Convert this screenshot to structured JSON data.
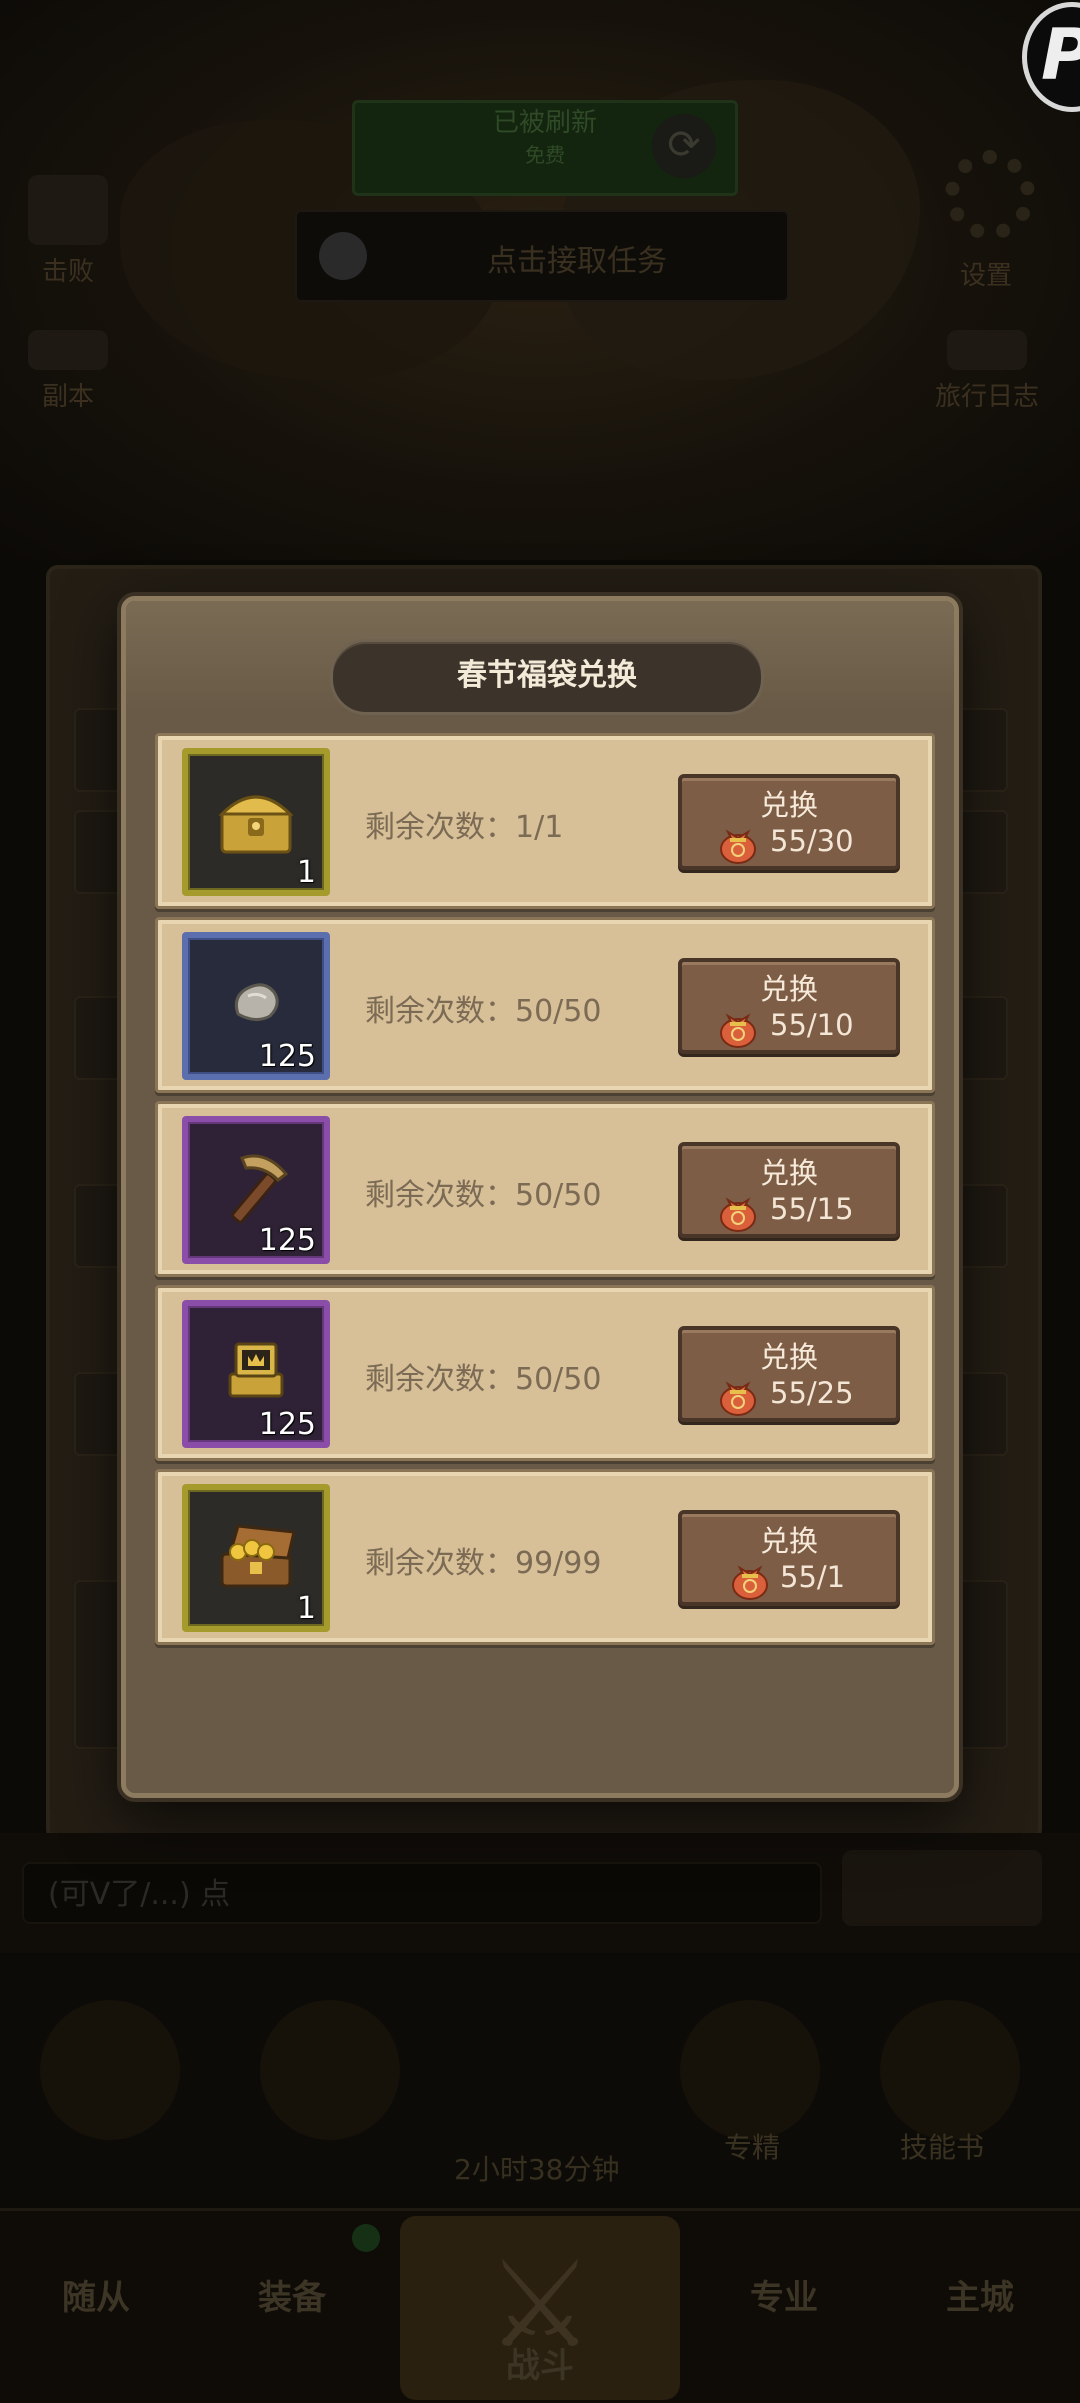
{
  "background": {
    "banner_text": "已被刷新",
    "banner_sub": "免费",
    "task_text": "点击接取任务",
    "left_label_1": "击败",
    "left_label_2": "副本",
    "right_label_1": "设置",
    "right_label_2": "旅行日志",
    "input_text": "(可V了/...) 点",
    "action_timer": "2小时38分钟",
    "action_label_1": "专精",
    "action_label_2": "技能书",
    "nav": [
      "随从",
      "装备",
      "战斗",
      "专业",
      "主城"
    ]
  },
  "modal": {
    "title": "春节福袋兑换",
    "items": [
      {
        "icon": "gold-chest-icon",
        "rarity": "gold",
        "quantity": "1",
        "remaining": "剩余次数：1/1",
        "button_label": "兑换",
        "cost": "55/30"
      },
      {
        "icon": "stone-ore-icon",
        "rarity": "blue",
        "quantity": "125",
        "remaining": "剩余次数：50/50",
        "button_label": "兑换",
        "cost": "55/10"
      },
      {
        "icon": "pickaxe-icon",
        "rarity": "purple",
        "quantity": "125",
        "remaining": "剩余次数：50/50",
        "button_label": "兑换",
        "cost": "55/15"
      },
      {
        "icon": "treasure-box-icon",
        "rarity": "purple",
        "quantity": "125",
        "remaining": "剩余次数：50/50",
        "button_label": "兑换",
        "cost": "55/25"
      },
      {
        "icon": "gold-coin-chest-icon",
        "rarity": "gold",
        "quantity": "1",
        "remaining": "剩余次数：99/99",
        "button_label": "兑换",
        "cost": "55/1"
      }
    ],
    "currency_icon": "lucky-bag-icon"
  },
  "colors": {
    "modal_bg": "#685a46",
    "row_bg": "#d7bf97",
    "button_bg": "#7d5d46",
    "title_plate": "#3c342b",
    "rarity_gold": "#a59a2c",
    "rarity_blue": "#5b6fae",
    "rarity_purple": "#8a4ea8"
  }
}
